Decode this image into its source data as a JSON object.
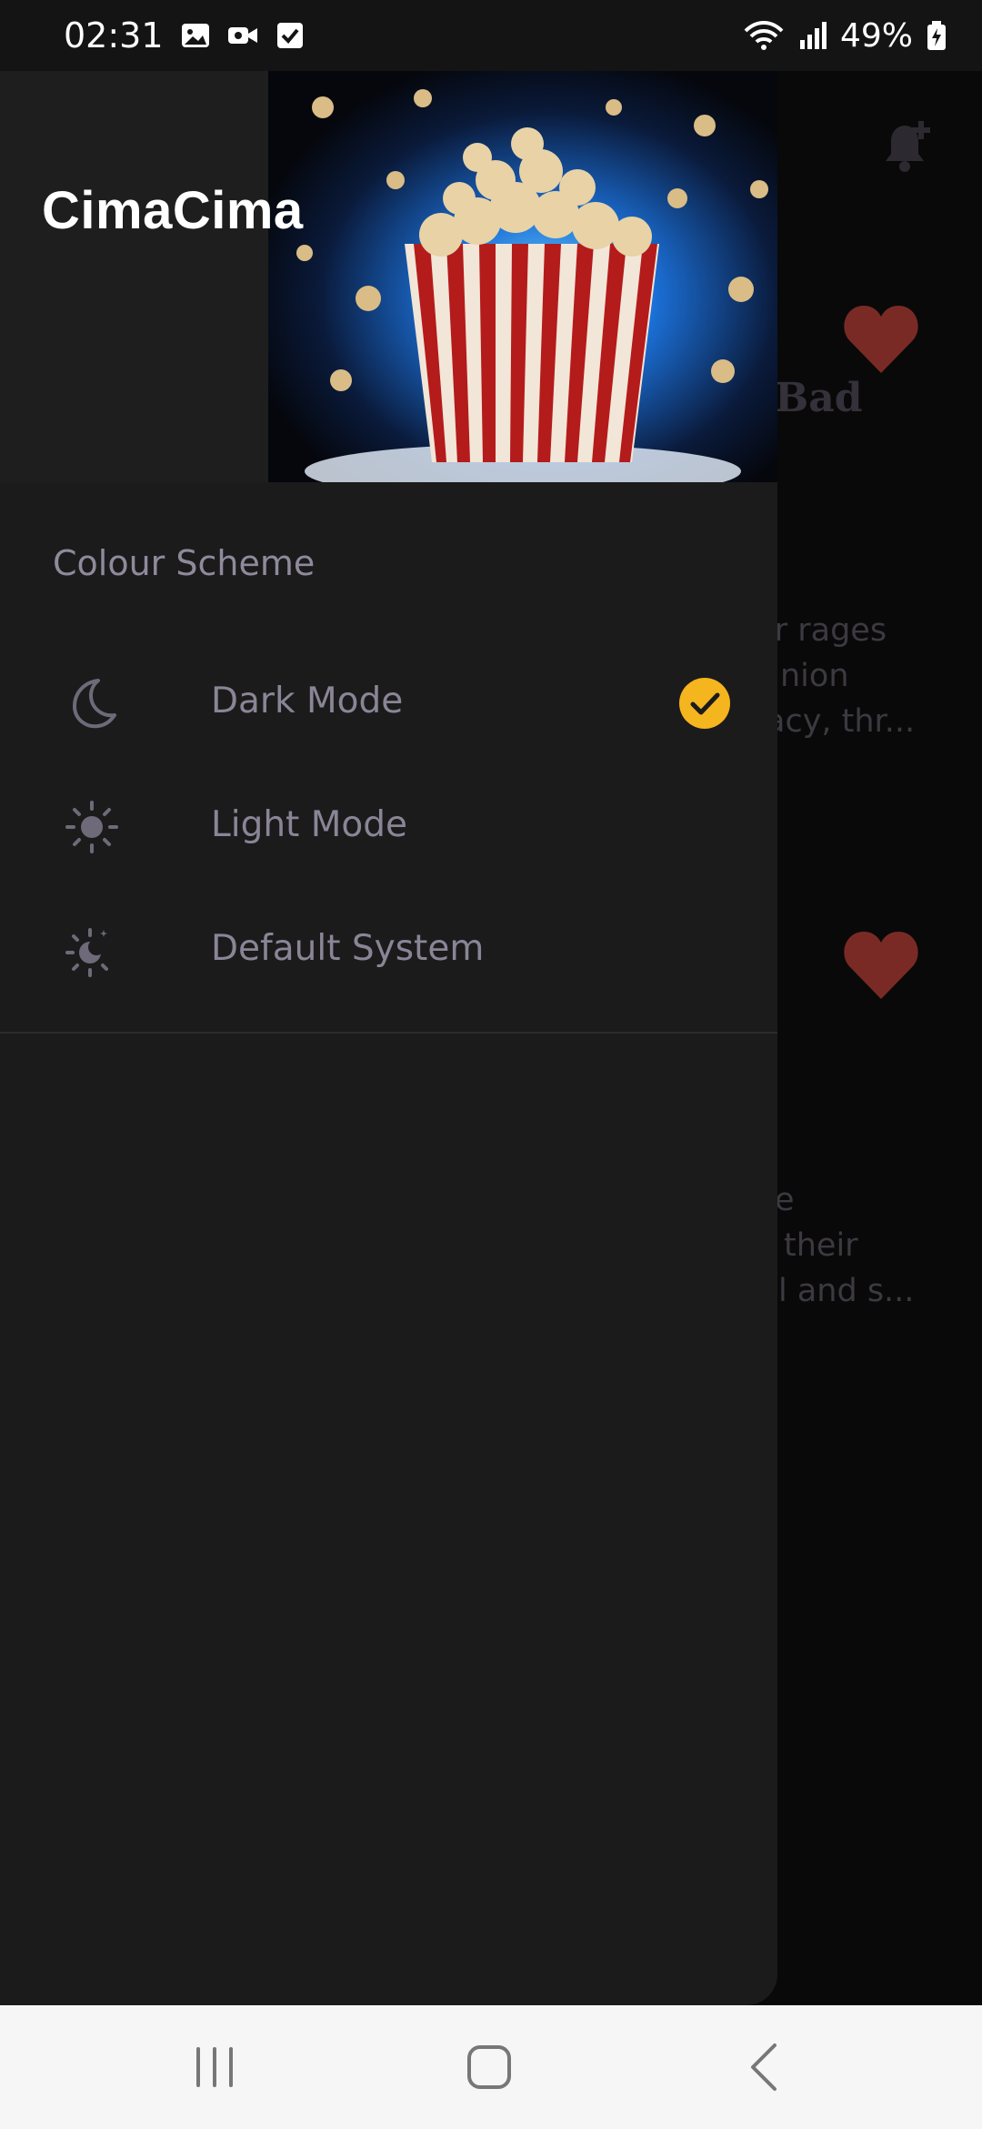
{
  "status_bar": {
    "time": "02:31",
    "battery": "49%",
    "icons": [
      "image-icon",
      "video-camera-icon",
      "checkbox-icon",
      "wifi-icon",
      "signal-icon",
      "battery-icon"
    ]
  },
  "drawer": {
    "app_title": "CimaCima",
    "section_label": "Colour Scheme",
    "options": [
      {
        "label": "Dark Mode",
        "icon": "moon-icon",
        "selected": true
      },
      {
        "label": "Light Mode",
        "icon": "sun-icon",
        "selected": false
      },
      {
        "label": "Default System",
        "icon": "sun-moon-icon",
        "selected": false
      }
    ],
    "accent_color": "#F5B51E"
  },
  "background": {
    "title_fragment": "Bad",
    "text_block_1": [
      "ır rages",
      "nion",
      "acy, thr..."
    ],
    "text_block_2": [
      "e",
      "their",
      "l and s..."
    ],
    "heart_color": "#7A2A25"
  }
}
